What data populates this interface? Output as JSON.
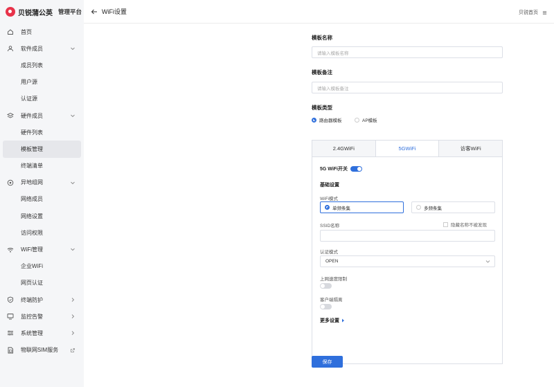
{
  "brand": {
    "name": "贝锐蒲公英",
    "subtitle": "管理平台"
  },
  "topbar": {
    "title": "WiFi设置",
    "home_link": "贝锐首页"
  },
  "sidebar": {
    "items": [
      {
        "label": "首页",
        "icon": "home-icon",
        "type": "top"
      },
      {
        "label": "软件成员",
        "icon": "user-icon",
        "type": "group"
      },
      {
        "label": "成员列表",
        "type": "sub"
      },
      {
        "label": "用户源",
        "type": "sub"
      },
      {
        "label": "认证源",
        "type": "sub"
      },
      {
        "label": "硬件成员",
        "icon": "layers-icon",
        "type": "group"
      },
      {
        "label": "硬件列表",
        "type": "sub"
      },
      {
        "label": "模板管理",
        "type": "sub",
        "active": true
      },
      {
        "label": "终端清单",
        "type": "sub"
      },
      {
        "label": "异地组网",
        "icon": "network-icon",
        "type": "group"
      },
      {
        "label": "网络成员",
        "type": "sub"
      },
      {
        "label": "网络设置",
        "type": "sub"
      },
      {
        "label": "访问权限",
        "type": "sub"
      },
      {
        "label": "WiFi管理",
        "icon": "wifi-icon",
        "type": "group"
      },
      {
        "label": "企业WiFi",
        "type": "sub"
      },
      {
        "label": "网页认证",
        "type": "sub"
      },
      {
        "label": "终端防护",
        "icon": "shield-icon",
        "type": "collapsed"
      },
      {
        "label": "监控告警",
        "icon": "monitor-icon",
        "type": "collapsed"
      },
      {
        "label": "系统管理",
        "icon": "sliders-icon",
        "type": "collapsed"
      },
      {
        "label": "物联网SIM服务",
        "icon": "sim-icon",
        "type": "external"
      }
    ]
  },
  "form": {
    "template_name": {
      "label": "模板名称",
      "placeholder": "请输入模板名称"
    },
    "template_note": {
      "label": "模板备注",
      "placeholder": "请输入模板备注"
    },
    "template_type": {
      "label": "模板类型",
      "options": [
        "路由器模板",
        "AP模板"
      ],
      "selected": "路由器模板"
    }
  },
  "tabs": [
    "2.4GWiFi",
    "5GWiFi",
    "访客WiFi"
  ],
  "active_tab": "5GWiFi",
  "wifi5g": {
    "switch_label": "5G WiFi开关",
    "switch_on": true,
    "basic_section": "基础设置",
    "wifi_mode_label": "WiFi模式",
    "wifi_modes": [
      "单频条集",
      "多频条集"
    ],
    "wifi_mode_selected": "单频条集",
    "ssid_label": "SSID名称",
    "hide_ssid_label": "隐藏名称不被发现",
    "auth_label": "认证模式",
    "auth_value": "OPEN",
    "speed_limit_label": "上网速度限制",
    "speed_limit_on": false,
    "isolation_label": "客户端隔离",
    "isolation_on": false,
    "more_settings": "更多设置"
  },
  "save_button": "保存",
  "colors": {
    "accent": "#2f6fdc",
    "brand": "#e8334a",
    "sidebar_bg": "#f5f6f8"
  }
}
